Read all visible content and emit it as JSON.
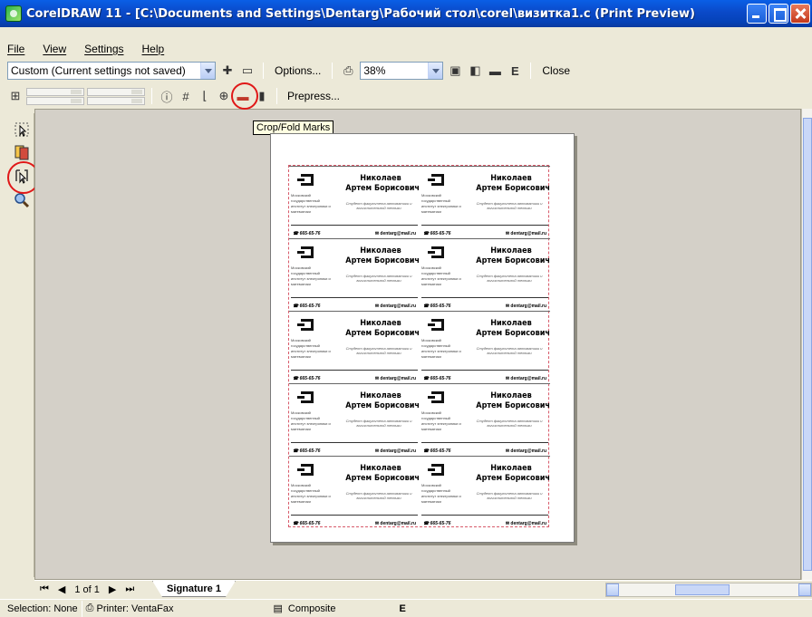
{
  "window": {
    "title": "CorelDRAW 11 - [C:\\Documents and Settings\\Dentarg\\Рабочий стол\\corel\\визитка1.c (Print Preview)"
  },
  "menu": [
    "File",
    "View",
    "Settings",
    "Help"
  ],
  "toolbar": {
    "print_style": "Custom (Current settings not saved)",
    "options_label": "Options...",
    "zoom": "38%",
    "close_label": "Close",
    "prepress_label": "Prepress..."
  },
  "tooltip": "Crop/Fold Marks",
  "card": {
    "name_line1": "Николаев",
    "name_line2": "Артем Борисович",
    "institute": "Московский государственный институт электроники и математики",
    "position": "Студент факультета автоматики и вычислительной техники",
    "phone": "☎ 665-65-76",
    "email": "✉ dentarg@mail.ru"
  },
  "bottom": {
    "page_info": "1 of 1",
    "signature_tab": "Signature 1"
  },
  "status": {
    "selection": "Selection: None",
    "printer": "Printer: VentaFax",
    "composite": "Composite"
  },
  "colors": {
    "titlebar": "#0a49c8",
    "highlight_circle": "#e01818",
    "crop_marks": "#d85a6a"
  }
}
